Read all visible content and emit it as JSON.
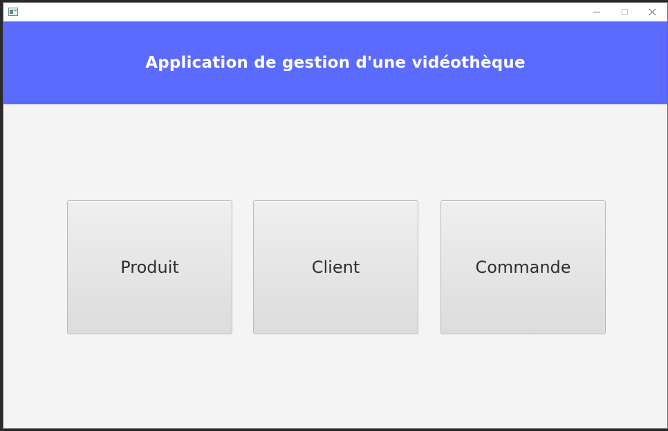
{
  "window": {
    "title": "",
    "controls": {
      "minimize_icon": "minimize-icon",
      "maximize_icon": "maximize-icon",
      "close_icon": "close-icon"
    }
  },
  "header": {
    "title": "Application de gestion d'une vidéothèque",
    "background_color": "#5b6bff",
    "text_color": "#ffffff"
  },
  "menu": {
    "buttons": [
      {
        "label": "Produit"
      },
      {
        "label": "Client"
      },
      {
        "label": "Commande"
      }
    ]
  },
  "colors": {
    "content_background": "#f4f4f4",
    "button_border": "#b9b9b9",
    "button_text": "#2f2f2f"
  }
}
